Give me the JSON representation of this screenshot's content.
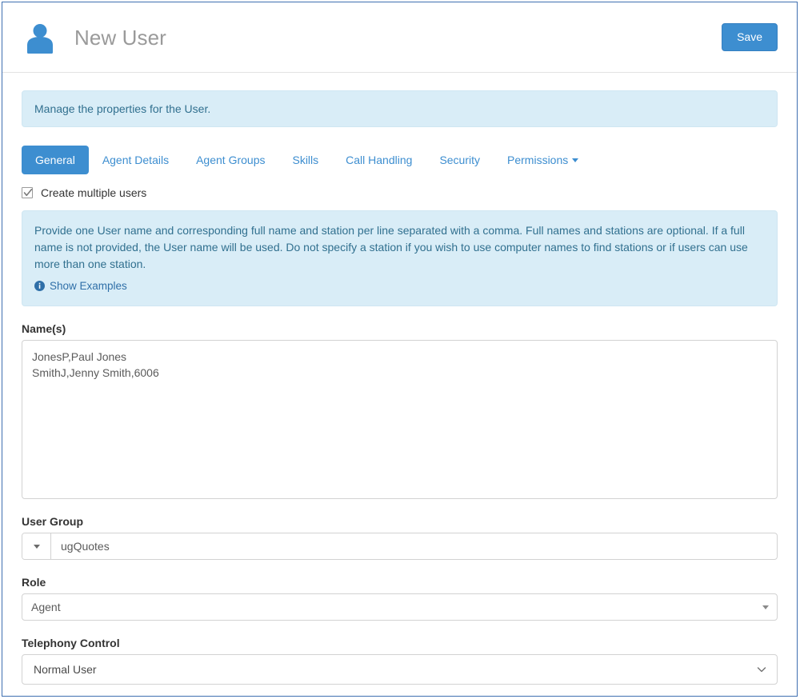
{
  "header": {
    "avatar_icon": "user-avatar-icon",
    "title": "New User",
    "save_label": "Save"
  },
  "info_banner": {
    "text": "Manage the properties for the User."
  },
  "tabs": [
    {
      "label": "General",
      "active": true
    },
    {
      "label": "Agent Details",
      "active": false
    },
    {
      "label": "Agent Groups",
      "active": false
    },
    {
      "label": "Skills",
      "active": false
    },
    {
      "label": "Call Handling",
      "active": false
    },
    {
      "label": "Security",
      "active": false
    },
    {
      "label": "Permissions",
      "active": false,
      "caret": true
    }
  ],
  "create_multiple": {
    "label": "Create multiple users",
    "checked": true
  },
  "instructions": {
    "text": "Provide one User name and corresponding full name and station per line separated with a comma. Full names and stations are optional. If a full name is not provided, the User name will be used. Do not specify a station if you wish to use computer names to find stations or if users can use more than one station.",
    "examples_link": "Show Examples",
    "examples_icon": "info-circle-icon"
  },
  "fields": {
    "names": {
      "label": "Name(s)",
      "value": "JonesP,Paul Jones\nSmithJ,Jenny Smith,6006",
      "placeholder": ""
    },
    "user_group": {
      "label": "User Group",
      "value": "ugQuotes",
      "placeholder": "",
      "caret_icon": "caret-down-icon"
    },
    "role": {
      "label": "Role",
      "value": "Agent",
      "placeholder": "",
      "arrow_icon": "caret-down-icon"
    },
    "telephony_control": {
      "label": "Telephony Control",
      "value": "Normal User",
      "chevron_icon": "chevron-down-icon"
    }
  },
  "colors": {
    "accent": "#3d8ed0",
    "banner_bg": "#d9edf7",
    "banner_text": "#31708f",
    "frame_border": "#3f6fb0",
    "title_text": "#9a9a9a"
  }
}
